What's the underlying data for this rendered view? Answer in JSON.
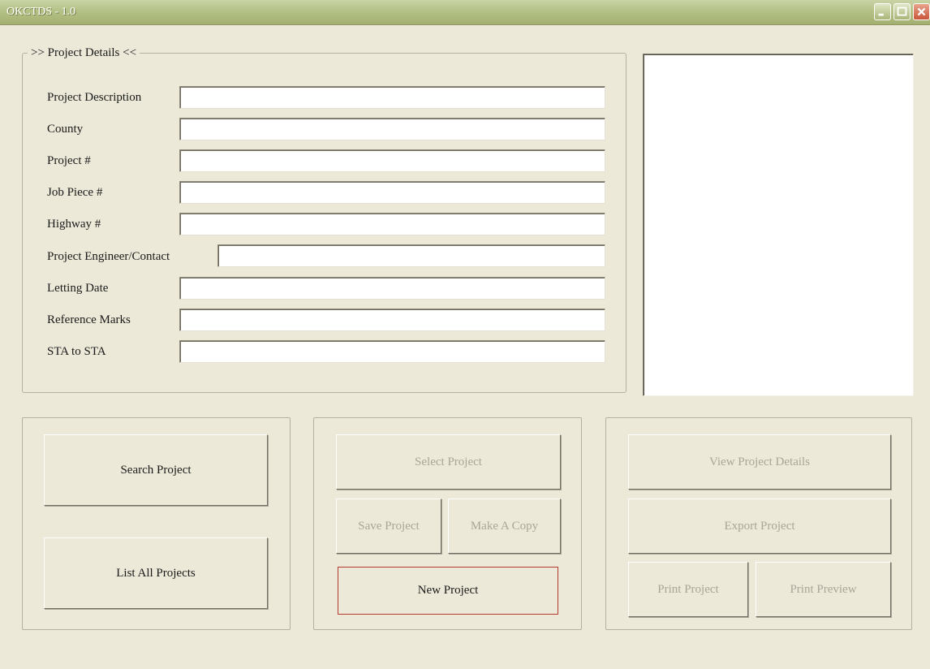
{
  "window": {
    "title": "OKCTDS - 1.0"
  },
  "details": {
    "legend": ">> Project Details <<",
    "fields": [
      {
        "label": "Project Description",
        "value": ""
      },
      {
        "label": "County",
        "value": ""
      },
      {
        "label": "Project #",
        "value": ""
      },
      {
        "label": "Job Piece #",
        "value": ""
      },
      {
        "label": "Highway #",
        "value": ""
      },
      {
        "label": "Project Engineer/Contact",
        "value": ""
      },
      {
        "label": "Letting Date",
        "value": ""
      },
      {
        "label": "Reference Marks",
        "value": ""
      },
      {
        "label": "STA to STA",
        "value": ""
      }
    ]
  },
  "buttons": {
    "search_project": "Search Project",
    "list_all_projects": "List All Projects",
    "select_project": "Select Project",
    "save_project": "Save Project",
    "make_a_copy": "Make A Copy",
    "new_project": "New Project",
    "view_project_details": "View Project Details",
    "export_project": "Export Project",
    "print_project": "Print Project",
    "print_preview": "Print Preview"
  },
  "icons": {
    "minimize": "minimize-icon",
    "maximize": "maximize-icon",
    "close": "close-icon"
  },
  "colors": {
    "titlebar": "#b4c186",
    "window_bg": "#ece9d8",
    "disabled_text": "#a8a698",
    "focus_border": "#b03a2e"
  }
}
